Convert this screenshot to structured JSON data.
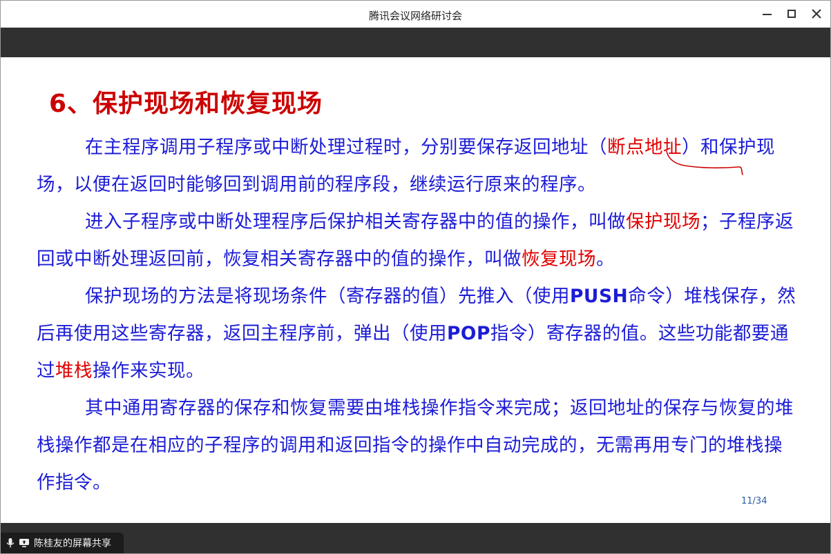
{
  "window": {
    "title": "腾讯会议网络研讨会"
  },
  "slide": {
    "title": "6、保护现场和恢复现场",
    "page_number": "11/34",
    "paragraphs": [
      {
        "segments": [
          {
            "text": "在主程序调用子程序或中断处理过程时，分别要保存返回地址（",
            "style": "normal"
          },
          {
            "text": "断点地址",
            "style": "red"
          },
          {
            "text": "）和保护现场，以便在返回时能够回到调用前的程序段，继续运行原来的程序。",
            "style": "normal"
          }
        ]
      },
      {
        "segments": [
          {
            "text": "进入子程序或中断处理程序后保护相关寄存器中的值的操作，叫做",
            "style": "normal"
          },
          {
            "text": "保护现场",
            "style": "red"
          },
          {
            "text": "；子程序返回或中断处理返回前，恢复相关寄存器中的值的操作，叫做",
            "style": "normal"
          },
          {
            "text": "恢复现场",
            "style": "red"
          },
          {
            "text": "。",
            "style": "normal"
          }
        ]
      },
      {
        "segments": [
          {
            "text": "保护现场的方法是将现场条件（寄存器的值）先推入（使用",
            "style": "normal"
          },
          {
            "text": "PUSH",
            "style": "bold"
          },
          {
            "text": "命令）堆栈保存，然后再使用这些寄存器，返回主程序前，弹出（使用",
            "style": "normal"
          },
          {
            "text": "POP",
            "style": "bold"
          },
          {
            "text": "指令）寄存器的值。这些功能都要通过",
            "style": "normal"
          },
          {
            "text": "堆栈",
            "style": "red"
          },
          {
            "text": "操作来实现。",
            "style": "normal"
          }
        ]
      },
      {
        "segments": [
          {
            "text": "其中通用寄存器的保存和恢复需要由堆栈操作指令来完成；返回地址的保存与恢复的堆栈操作都是在相应的子程序的调用和返回指令的操作中自动完成的，无需再用专门的堆栈操作指令。",
            "style": "normal"
          }
        ]
      }
    ]
  },
  "status": {
    "share_label": "陈桂友的屏幕共享",
    "mic_icon": "microphone-icon",
    "screen_icon": "screen-share-icon"
  },
  "colors": {
    "title_red": "#cc0000",
    "body_blue": "#1c1cd6",
    "highlight_red": "#e00000",
    "dark_bar": "#303030"
  }
}
